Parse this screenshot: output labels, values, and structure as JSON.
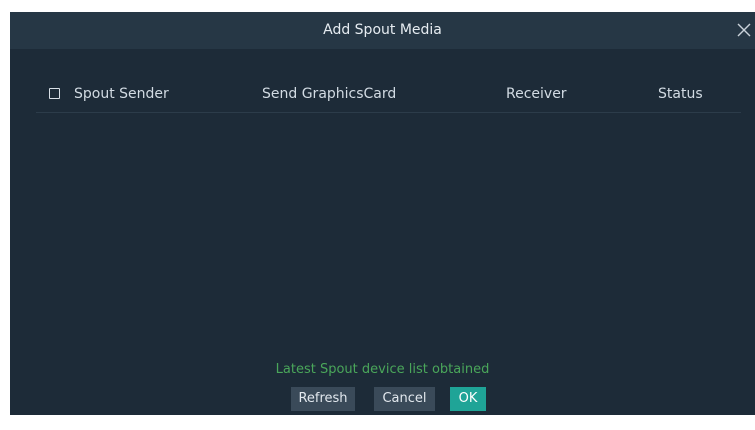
{
  "dialog": {
    "title": "Add Spout Media",
    "close_icon": "close-icon"
  },
  "table": {
    "headers": {
      "sender": "Spout Sender",
      "graphics_card": "Send GraphicsCard",
      "receiver": "Receiver",
      "status": "Status"
    },
    "select_all_checked": false,
    "rows": []
  },
  "footer": {
    "status_message": "Latest Spout device list obtained",
    "refresh_label": "Refresh",
    "cancel_label": "Cancel",
    "ok_label": "OK"
  },
  "colors": {
    "background": "#1d2b38",
    "titlebar": "#263745",
    "status_text": "#4aa65a",
    "ok_button": "#1fa497",
    "button": "#3a4a59"
  }
}
